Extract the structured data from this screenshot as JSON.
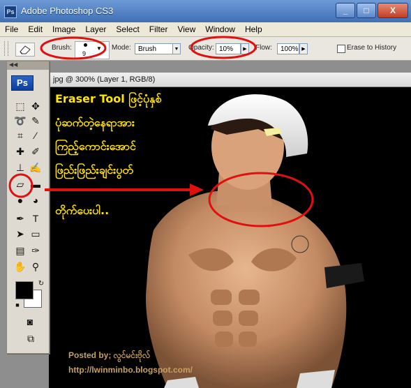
{
  "window": {
    "title": "Adobe Photoshop CS3",
    "app_icon": "Ps",
    "minimize": "_",
    "maximize": "□",
    "close": "X"
  },
  "menu": [
    "File",
    "Edit",
    "Image",
    "Layer",
    "Select",
    "Filter",
    "View",
    "Window",
    "Help"
  ],
  "options": {
    "brush_label": "Brush:",
    "brush_size": "9",
    "mode_label": "Mode:",
    "mode_value": "Brush",
    "opacity_label": "Opacity:",
    "opacity_value": "10%",
    "flow_label": "Flow:",
    "flow_value": "100%",
    "erase_history_label": "Erase to History"
  },
  "document": {
    "tab_title": "jpg @ 300% (Layer 1, RGB/8)"
  },
  "toolbox": {
    "logo": "Ps",
    "collapse": "◀◀"
  },
  "annotation": {
    "caption_lines": [
      "Eraser Tool ဖြင့်ပုံနှစ်",
      "ပုံဆက်တဲ့နေရာအား",
      "ကြည့်ကောင်းအောင်",
      "ဖြည်းဖြည်းချင်းပွတ်",
      "တိုက်ပေးပါ.."
    ],
    "posted_by": "Posted by; လွင်မင်းဗိုလ်",
    "blog_url": "http://lwinminbo.blogspot.com/"
  },
  "colors": {
    "caption": "#ffe500",
    "highlight_circle": "#e01010",
    "title_bar": "#3f6fb6"
  }
}
